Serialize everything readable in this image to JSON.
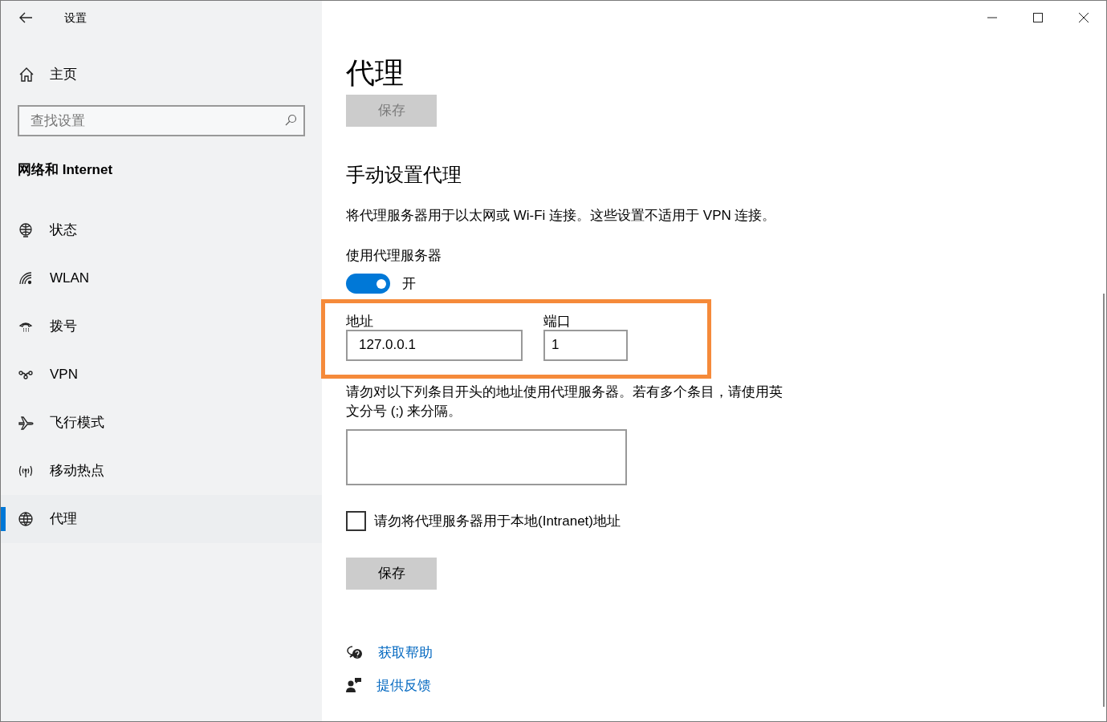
{
  "window": {
    "title": "设置"
  },
  "sidebar": {
    "home": "主页",
    "search": {
      "placeholder": "查找设置"
    },
    "section": "网络和 Internet",
    "items": [
      {
        "label": "状态",
        "selected": false
      },
      {
        "label": "WLAN",
        "selected": false
      },
      {
        "label": "拨号",
        "selected": false
      },
      {
        "label": "VPN",
        "selected": false
      },
      {
        "label": "飞行模式",
        "selected": false
      },
      {
        "label": "移动热点",
        "selected": false
      },
      {
        "label": "代理",
        "selected": true
      }
    ]
  },
  "page": {
    "title": "代理",
    "top_save": {
      "label": "保存",
      "disabled": true
    },
    "section": "手动设置代理",
    "description": "将代理服务器用于以太网或 Wi-Fi 连接。这些设置不适用于 VPN 连接。",
    "use_proxy": {
      "label": "使用代理服务器",
      "on": true,
      "state_text": "开"
    },
    "address": {
      "label": "地址",
      "value": "127.0.0.1"
    },
    "port": {
      "label": "端口",
      "value": "1"
    },
    "exceptions": {
      "description": "请勿对以下列条目开头的地址使用代理服务器。若有多个条目，请使用英文分号 (;) 来分隔。"
    },
    "local_bypass": {
      "label": "请勿将代理服务器用于本地(Intranet)地址",
      "checked": false
    },
    "bottom_save": {
      "label": "保存",
      "disabled": false
    },
    "links": [
      "获取帮助",
      "提供反馈"
    ]
  }
}
